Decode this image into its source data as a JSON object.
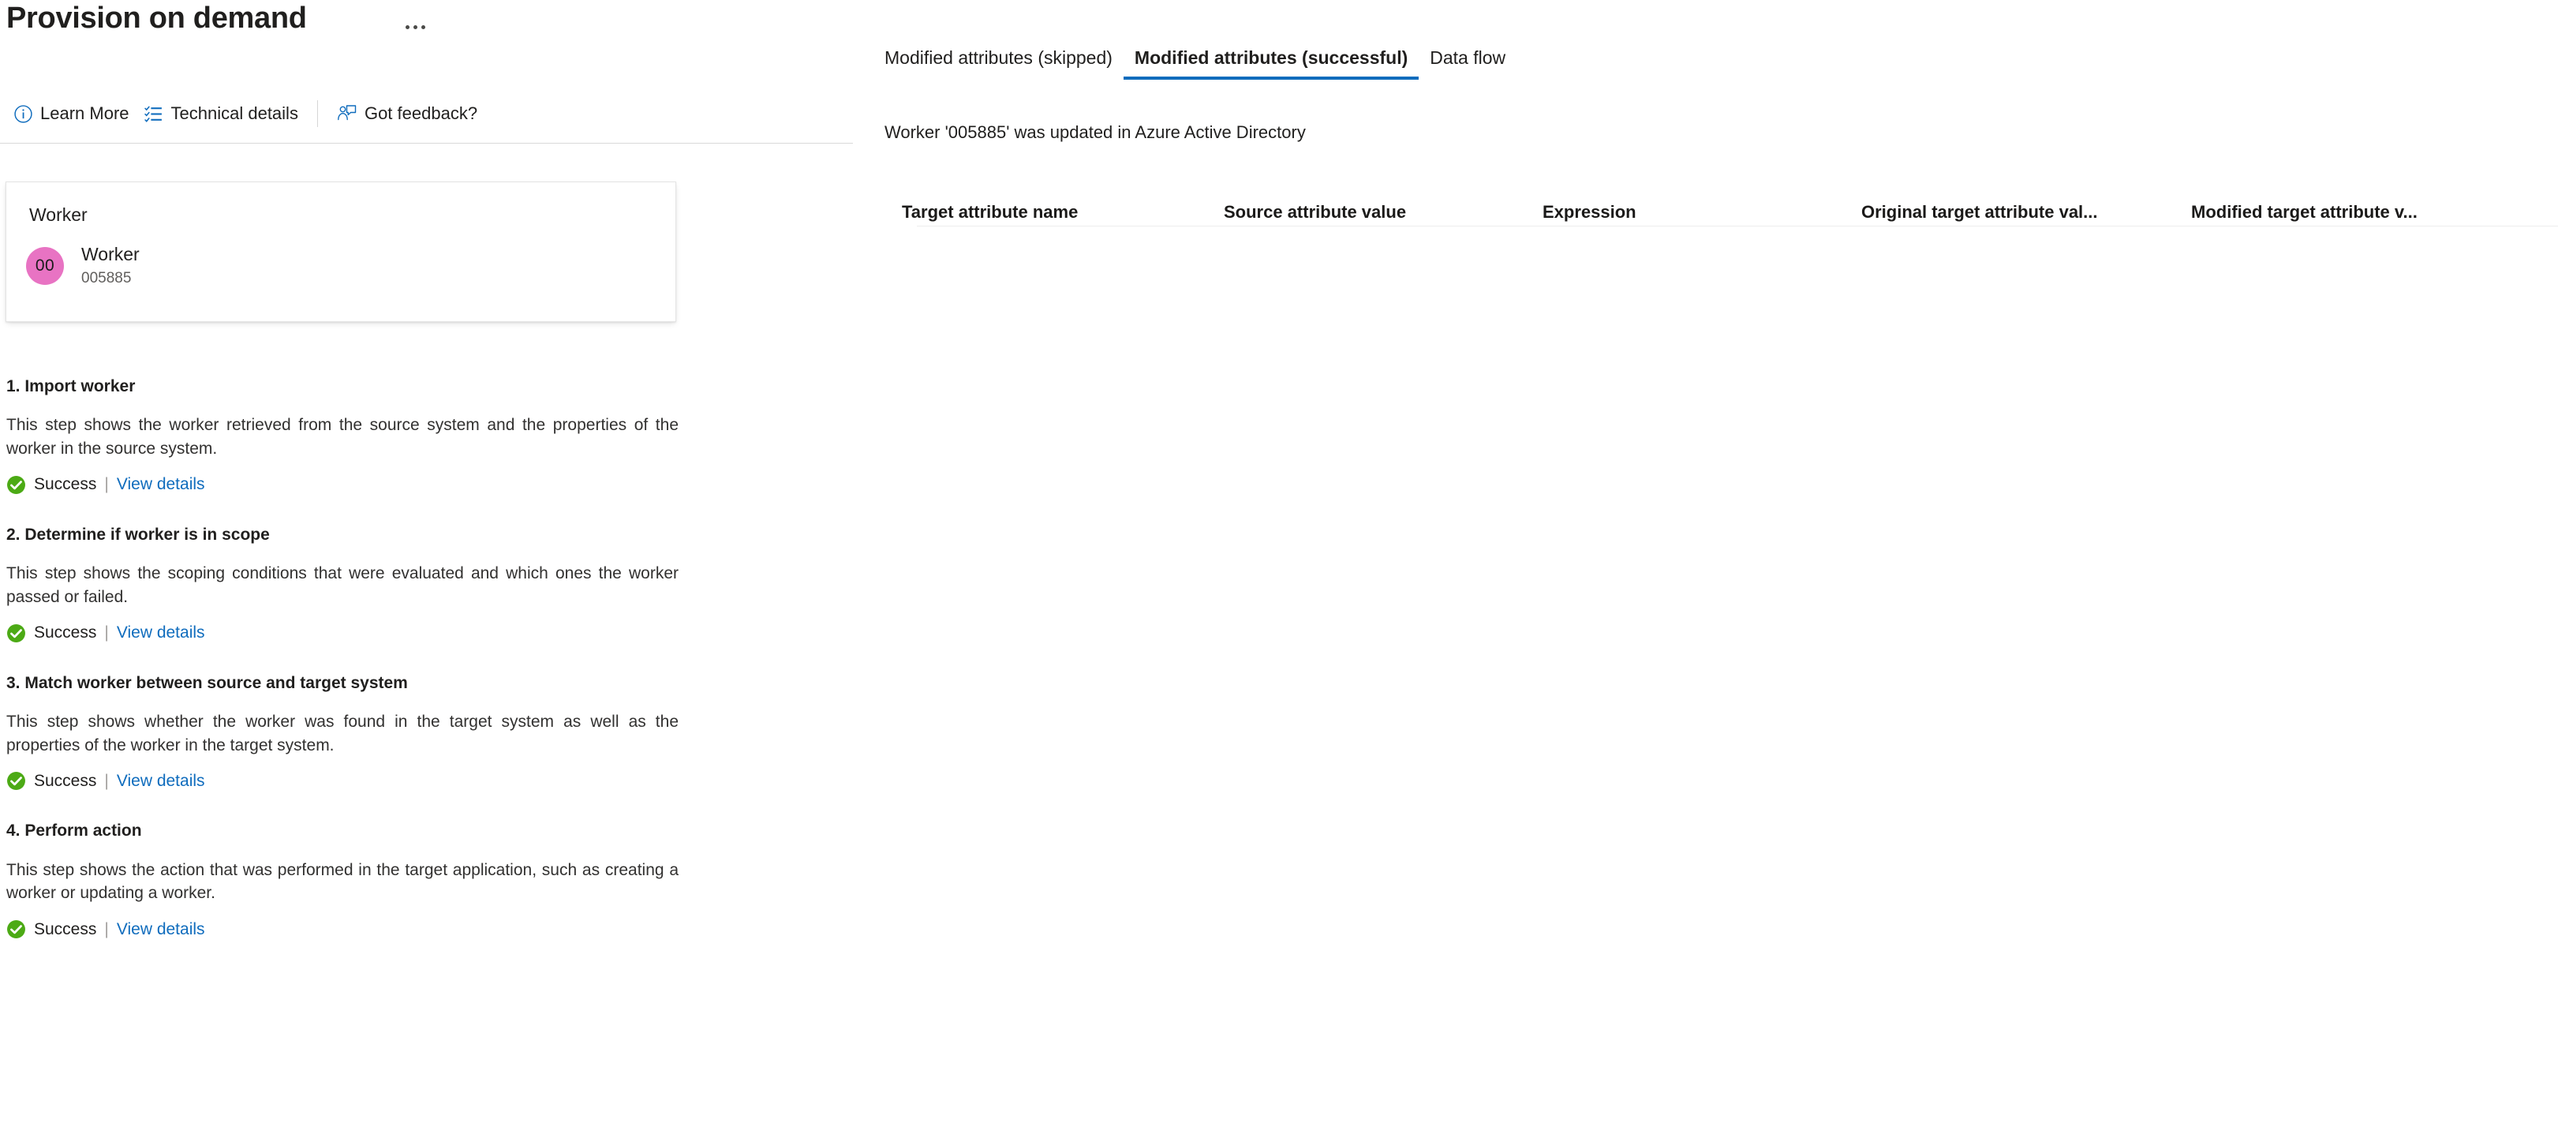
{
  "header": {
    "title": "Provision on demand",
    "more_menu_icon": "ellipsis-icon",
    "command_bar": [
      {
        "id": "learn-more",
        "label": "Learn More",
        "icon": "info-circle-icon"
      },
      {
        "id": "technical-details",
        "label": "Technical details",
        "icon": "checklist-icon"
      },
      {
        "id": "got-feedback",
        "label": "Got feedback?",
        "icon": "person-feedback-icon"
      }
    ]
  },
  "worker_card": {
    "title": "Worker",
    "avatar_initials": "00",
    "avatar_color": "#e873c3",
    "name": "Worker",
    "id": "005885"
  },
  "steps": [
    {
      "title": "1. Import worker",
      "description": "This step shows the worker retrieved from the source system and the properties of the worker in the source system.",
      "status": "Success",
      "status_icon": "success-check-icon",
      "status_color": "#4caa15",
      "separator": "|",
      "link": "View details"
    },
    {
      "title": "2. Determine if worker is in scope",
      "description": "This step shows the scoping conditions that were evaluated and which ones the worker passed or failed.",
      "status": "Success",
      "status_icon": "success-check-icon",
      "status_color": "#4caa15",
      "separator": "|",
      "link": "View details"
    },
    {
      "title": "3. Match worker between source and target system",
      "description": "This step shows whether the worker was found in the target system as well as the properties of the worker in the target system.",
      "status": "Success",
      "status_icon": "success-check-icon",
      "status_color": "#4caa15",
      "separator": "|",
      "link": "View details"
    },
    {
      "title": "4. Perform action",
      "description": "This step shows the action that was performed in the target application, such as creating a worker or updating a worker.",
      "status": "Success",
      "status_icon": "success-check-icon",
      "status_color": "#4caa15",
      "separator": "|",
      "link": "View details"
    }
  ],
  "details_panel": {
    "tabs": [
      {
        "id": "modified-attributes-skipped",
        "label": "Modified attributes (skipped)",
        "active": false
      },
      {
        "id": "modified-attributes-successful",
        "label": "Modified attributes (successful)",
        "active": true
      },
      {
        "id": "data-flow",
        "label": "Data flow",
        "active": false
      }
    ],
    "active_tab_accent": "#0f6cbd",
    "summary": "Worker '005885' was updated in Azure Active Directory",
    "table": {
      "columns": [
        "Target attribute name",
        "Source attribute value",
        "Expression",
        "Original target attribute val...",
        "Modified target attribute v..."
      ],
      "rows": []
    }
  }
}
